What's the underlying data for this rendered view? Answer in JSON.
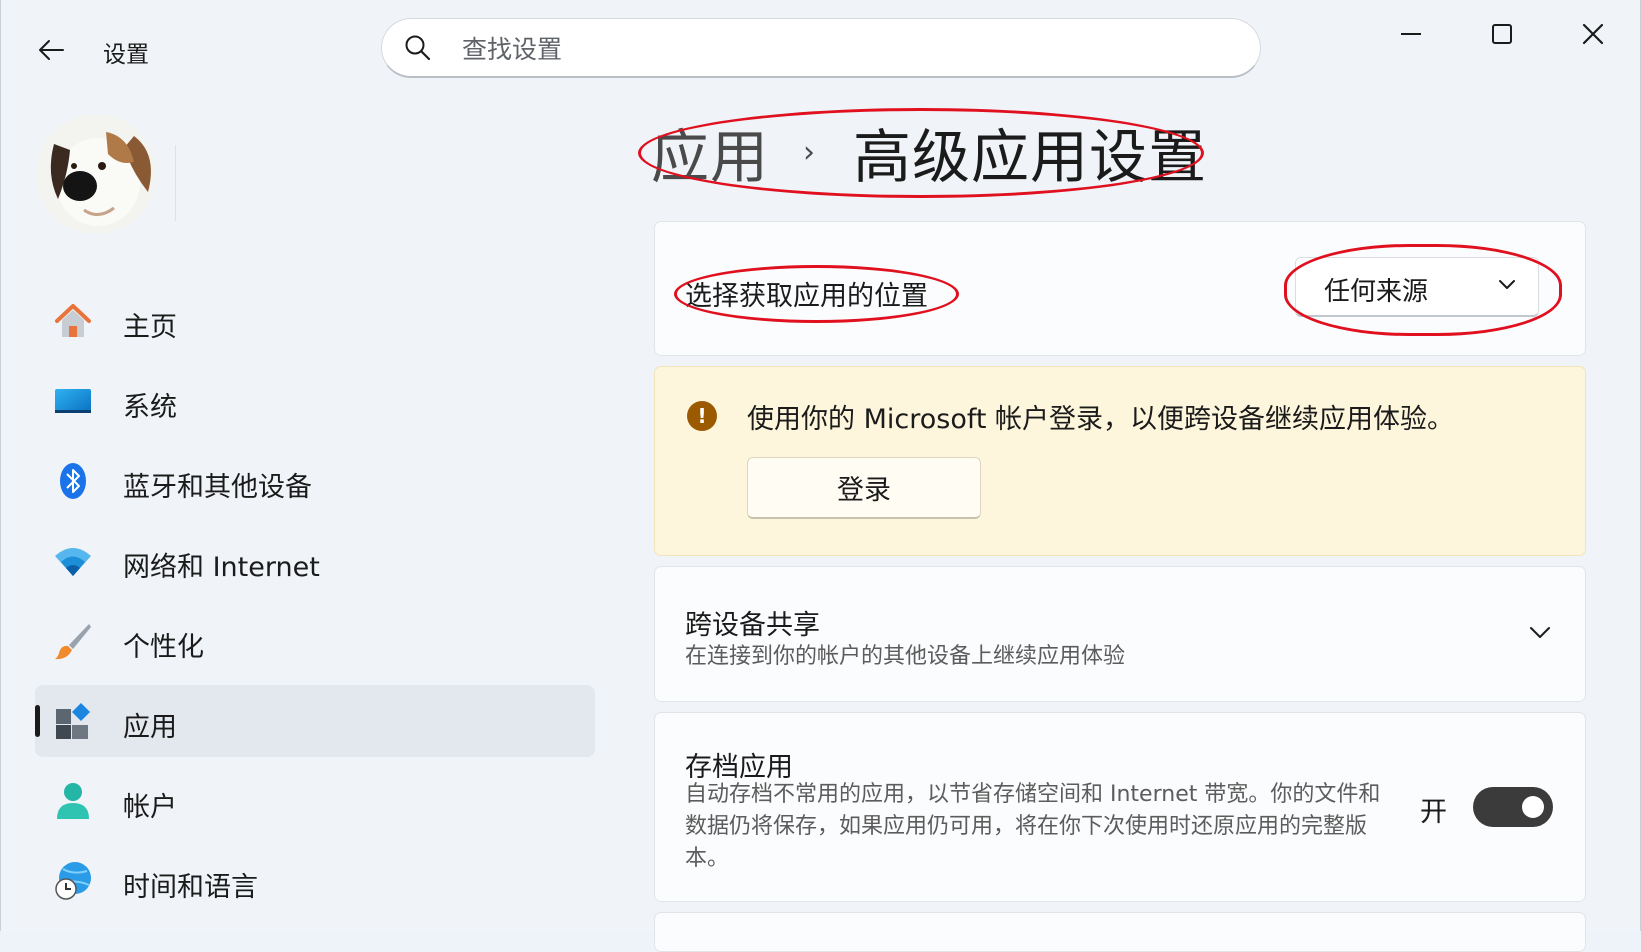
{
  "titlebar": {
    "app_title": "设置",
    "search_placeholder": "查找设置"
  },
  "sidebar": {
    "items": [
      {
        "label": "主页",
        "icon": "home-icon"
      },
      {
        "label": "系统",
        "icon": "system-icon"
      },
      {
        "label": "蓝牙和其他设备",
        "icon": "bluetooth-icon"
      },
      {
        "label": "网络和 Internet",
        "icon": "wifi-icon"
      },
      {
        "label": "个性化",
        "icon": "brush-icon"
      },
      {
        "label": "应用",
        "icon": "apps-icon",
        "selected": true
      },
      {
        "label": "帐户",
        "icon": "account-icon"
      },
      {
        "label": "时间和语言",
        "icon": "time-language-icon"
      }
    ]
  },
  "breadcrumb": {
    "parent": "应用",
    "separator": "›",
    "current": "高级应用设置"
  },
  "settings": {
    "app_source": {
      "label": "选择获取应用的位置",
      "selected_value": "任何来源"
    },
    "signin_banner": {
      "message": "使用你的 Microsoft 帐户登录，以便跨设备继续应用体验。",
      "button_label": "登录"
    },
    "cross_device": {
      "title": "跨设备共享",
      "subtitle": "在连接到你的帐户的其他设备上继续应用体验"
    },
    "archive_apps": {
      "title": "存档应用",
      "description": "自动存档不常用的应用，以节省存储空间和 Internet 带宽。你的文件和数据仍将保存，如果应用仍可用，将在你下次使用时还原应用的完整版本。",
      "toggle_label": "开",
      "toggle_on": true
    }
  },
  "colors": {
    "accent_highlight": "#e0101e",
    "warning_icon": "#9c5a00",
    "warning_background": "#fdf6dc"
  }
}
